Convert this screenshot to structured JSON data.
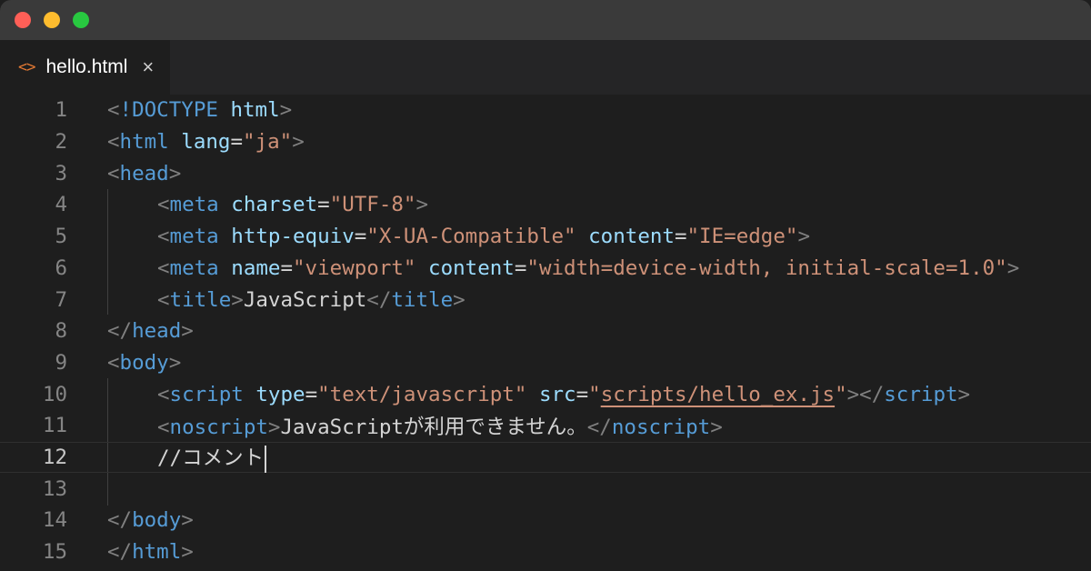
{
  "window": {
    "traffic_lights": {
      "close": "#ff5f57",
      "minimize": "#febc2e",
      "zoom": "#28c840"
    }
  },
  "tab": {
    "icon": "<>",
    "filename": "hello.html",
    "close": "×"
  },
  "colors": {
    "punct": "#808080",
    "tag": "#569cd6",
    "attr": "#9cdcfe",
    "string": "#ce9178",
    "text": "#d4d4d4"
  },
  "lines": [
    {
      "num": "1",
      "tokens": [
        "<",
        "!DOCTYPE",
        " html",
        ">"
      ]
    },
    {
      "num": "2",
      "tokens": [
        "<",
        "html",
        " ",
        "lang",
        "=",
        "\"ja\"",
        ">"
      ]
    },
    {
      "num": "3",
      "tokens": [
        "<",
        "head",
        ">"
      ]
    },
    {
      "num": "4",
      "tokens": [
        "<",
        "meta",
        " ",
        "charset",
        "=",
        "\"UTF-8\"",
        ">"
      ]
    },
    {
      "num": "5",
      "tokens": [
        "<",
        "meta",
        " ",
        "http-equiv",
        "=",
        "\"X-UA-Compatible\"",
        " ",
        "content",
        "=",
        "\"IE=edge\"",
        ">"
      ]
    },
    {
      "num": "6",
      "tokens": [
        "<",
        "meta",
        " ",
        "name",
        "=",
        "\"viewport\"",
        " ",
        "content",
        "=",
        "\"width=device-width, initial-scale=1.0\"",
        ">"
      ]
    },
    {
      "num": "7",
      "tokens": [
        "<",
        "title",
        ">",
        "JavaScript",
        "</",
        "title",
        ">"
      ]
    },
    {
      "num": "8",
      "tokens": [
        "</",
        "head",
        ">"
      ]
    },
    {
      "num": "9",
      "tokens": [
        "<",
        "body",
        ">"
      ]
    },
    {
      "num": "10",
      "tokens": [
        "<",
        "script",
        " ",
        "type",
        "=",
        "\"text/javascript\"",
        " ",
        "src",
        "=",
        "\"",
        "scripts/hello_ex.js",
        "\"",
        "></",
        "script",
        ">"
      ]
    },
    {
      "num": "11",
      "tokens": [
        "<",
        "noscript",
        ">",
        "JavaScriptが利用できません。",
        "</",
        "noscript",
        ">"
      ]
    },
    {
      "num": "12",
      "tokens": [
        "//コメント"
      ]
    },
    {
      "num": "13",
      "tokens": []
    },
    {
      "num": "14",
      "tokens": [
        "</",
        "body",
        ">"
      ]
    },
    {
      "num": "15",
      "tokens": [
        "</",
        "html",
        ">"
      ]
    }
  ]
}
